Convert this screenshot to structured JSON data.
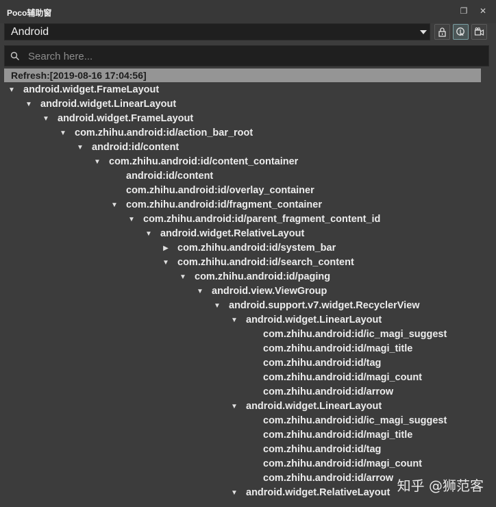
{
  "window": {
    "title": "Poco辅助窗",
    "restore_glyph": "❐",
    "close_glyph": "✕"
  },
  "toolbar": {
    "device_value": "Android",
    "lock_button": "lock-icon",
    "inspect_button": "inspect-icon",
    "record_button": "video-record-icon"
  },
  "search": {
    "placeholder": "Search here..."
  },
  "tree": {
    "refresh_label": "Refresh:[2019-08-16 17:04:56]",
    "nodes": [
      {
        "depth": 0,
        "toggle": "expanded",
        "label": "android.widget.FrameLayout"
      },
      {
        "depth": 1,
        "toggle": "expanded",
        "label": "android.widget.LinearLayout"
      },
      {
        "depth": 2,
        "toggle": "expanded",
        "label": "android.widget.FrameLayout"
      },
      {
        "depth": 3,
        "toggle": "expanded",
        "label": "com.zhihu.android:id/action_bar_root"
      },
      {
        "depth": 4,
        "toggle": "expanded",
        "label": "android:id/content"
      },
      {
        "depth": 5,
        "toggle": "expanded",
        "label": "com.zhihu.android:id/content_container"
      },
      {
        "depth": 6,
        "toggle": "none",
        "label": "android:id/content"
      },
      {
        "depth": 6,
        "toggle": "none",
        "label": "com.zhihu.android:id/overlay_container"
      },
      {
        "depth": 6,
        "toggle": "expanded",
        "label": "com.zhihu.android:id/fragment_container"
      },
      {
        "depth": 7,
        "toggle": "expanded",
        "label": "com.zhihu.android:id/parent_fragment_content_id"
      },
      {
        "depth": 8,
        "toggle": "expanded",
        "label": "android.widget.RelativeLayout"
      },
      {
        "depth": 9,
        "toggle": "collapsed",
        "label": "com.zhihu.android:id/system_bar"
      },
      {
        "depth": 9,
        "toggle": "expanded",
        "label": "com.zhihu.android:id/search_content"
      },
      {
        "depth": 10,
        "toggle": "expanded",
        "label": "com.zhihu.android:id/paging"
      },
      {
        "depth": 11,
        "toggle": "expanded",
        "label": "android.view.ViewGroup"
      },
      {
        "depth": 12,
        "toggle": "expanded",
        "label": "android.support.v7.widget.RecyclerView"
      },
      {
        "depth": 13,
        "toggle": "expanded",
        "label": "android.widget.LinearLayout"
      },
      {
        "depth": 14,
        "toggle": "none",
        "label": "com.zhihu.android:id/ic_magi_suggest"
      },
      {
        "depth": 14,
        "toggle": "none",
        "label": "com.zhihu.android:id/magi_title"
      },
      {
        "depth": 14,
        "toggle": "none",
        "label": "com.zhihu.android:id/tag"
      },
      {
        "depth": 14,
        "toggle": "none",
        "label": "com.zhihu.android:id/magi_count"
      },
      {
        "depth": 14,
        "toggle": "none",
        "label": "com.zhihu.android:id/arrow"
      },
      {
        "depth": 13,
        "toggle": "expanded",
        "label": "android.widget.LinearLayout"
      },
      {
        "depth": 14,
        "toggle": "none",
        "label": "com.zhihu.android:id/ic_magi_suggest"
      },
      {
        "depth": 14,
        "toggle": "none",
        "label": "com.zhihu.android:id/magi_title"
      },
      {
        "depth": 14,
        "toggle": "none",
        "label": "com.zhihu.android:id/tag"
      },
      {
        "depth": 14,
        "toggle": "none",
        "label": "com.zhihu.android:id/magi_count"
      },
      {
        "depth": 14,
        "toggle": "none",
        "label": "com.zhihu.android:id/arrow"
      },
      {
        "depth": 13,
        "toggle": "expanded",
        "label": "android.widget.RelativeLayout"
      }
    ]
  },
  "watermark": "知乎 @狮范客",
  "colors": {
    "background": "#3c3c3c",
    "input_bg": "#1f1f1f",
    "refresh_bar": "#959595",
    "text": "#ececec"
  }
}
